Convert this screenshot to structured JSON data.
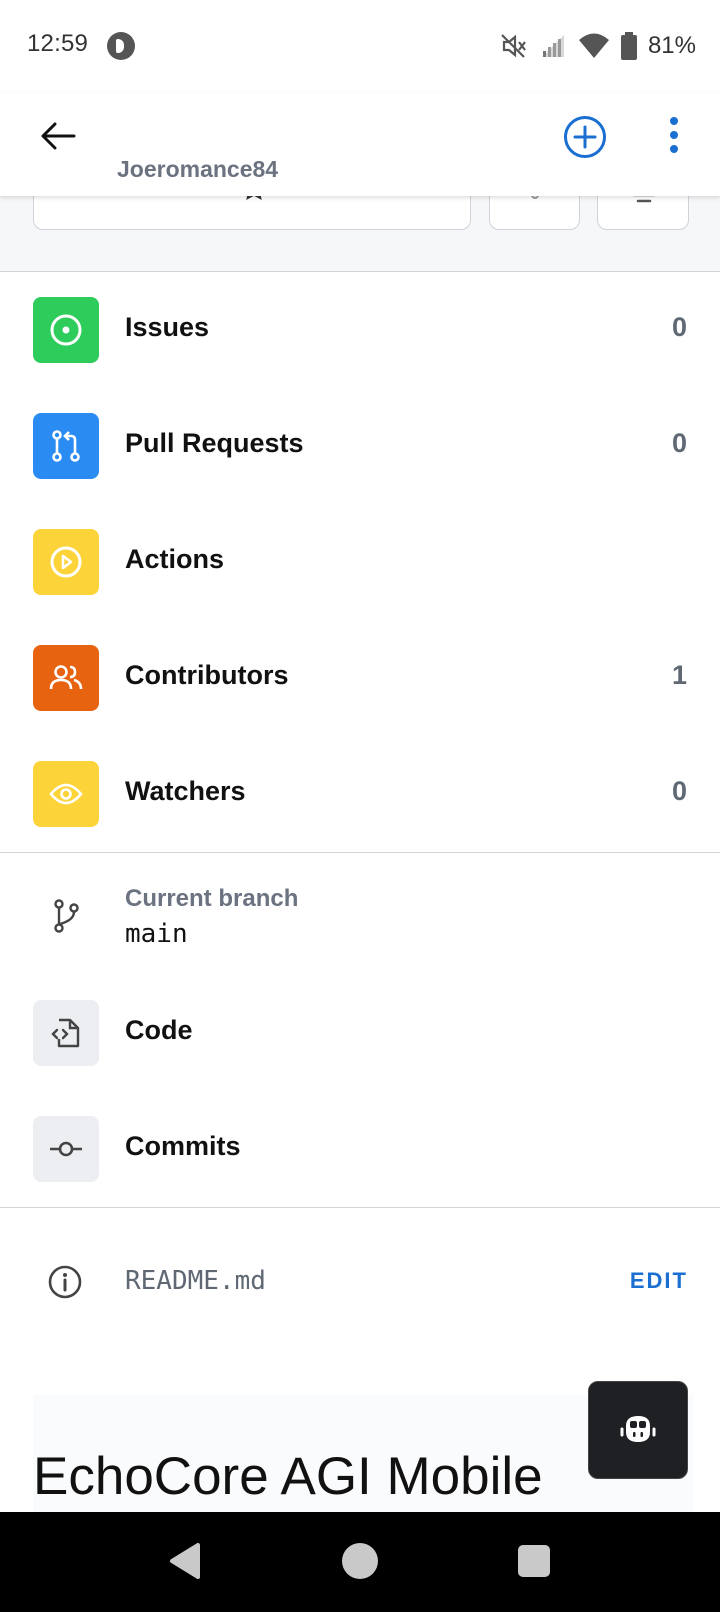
{
  "status_bar": {
    "time": "12:59",
    "battery": "81%",
    "icons": [
      "parking-app-icon",
      "mute-icon",
      "signal-icon",
      "wifi-icon",
      "battery-icon"
    ]
  },
  "app_bar": {
    "owner": "Joeromance84",
    "icons": [
      "back-arrow-icon",
      "add-circle-icon",
      "more-vert-icon"
    ]
  },
  "star_row": {
    "star_label": "STAR"
  },
  "menu": [
    {
      "label": "Issues",
      "count": "0",
      "icon": "issue-circle-icon",
      "color": "#2ecc5b"
    },
    {
      "label": "Pull Requests",
      "count": "0",
      "icon": "pull-request-icon",
      "color": "#2a8cf2"
    },
    {
      "label": "Actions",
      "count": "",
      "icon": "play-circle-icon",
      "color": "#fcd43a"
    },
    {
      "label": "Contributors",
      "count": "1",
      "icon": "people-icon",
      "color": "#e86310"
    },
    {
      "label": "Watchers",
      "count": "0",
      "icon": "eye-icon",
      "color": "#fcd43a"
    }
  ],
  "branch": {
    "caption": "Current branch",
    "name": "main"
  },
  "code_section": [
    {
      "label": "Code",
      "icon": "code-file-icon"
    },
    {
      "label": "Commits",
      "icon": "commit-icon"
    }
  ],
  "readme": {
    "filename": "README.md",
    "edit_label": "EDIT",
    "title": "EchoCore AGI Mobile"
  },
  "fab": {
    "icon": "copilot-icon"
  },
  "colors": {
    "accent": "#1a6fd1",
    "secondary_text": "#6b7280"
  }
}
